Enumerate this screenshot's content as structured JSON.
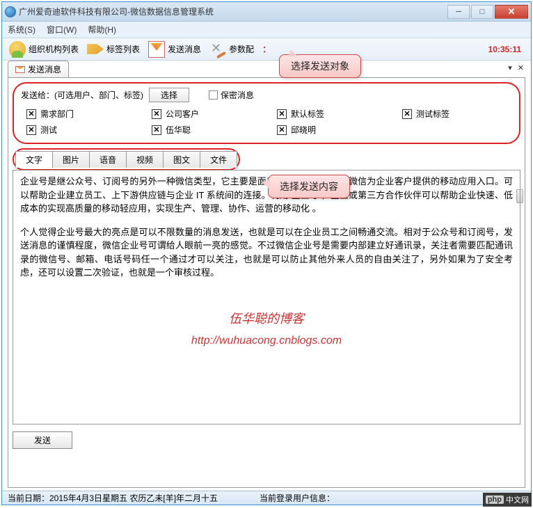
{
  "window": {
    "title": "广州爱奇迪软件科技有限公司-微信数据信息管理系统"
  },
  "menu": {
    "system": "系统(S)",
    "window": "窗口(W)",
    "help": "帮助(H)"
  },
  "toolbar": {
    "org": "组织机构列表",
    "tag": "标签列表",
    "msg": "发送消息",
    "settings": "参数配",
    "time": "10:35:11"
  },
  "tab": {
    "title": "发送消息",
    "dropdown": "▾",
    "close": "✕"
  },
  "callout": {
    "recipient": "选择发送对象",
    "content": "选择发送内容"
  },
  "recipient": {
    "label": "发送给：(可选用户、部门、标签)",
    "select_btn": "选择",
    "secret": "保密消息",
    "chips_row1": [
      "需求部门",
      "公司客户",
      "默认标签",
      "测试标签"
    ],
    "chips_row2": [
      "测试",
      "伍华聪",
      "邱晓明"
    ]
  },
  "content_tabs": [
    "文字",
    "图片",
    "语音",
    "视频",
    "图文",
    "文件"
  ],
  "editor": {
    "para1": "企业号是继公众号、订阅号的另外一种微信类型，它主要是面对企业的。企业号是微信为企业客户提供的移动应用入口。可以帮助企业建立员工、上下游供应链与企业 IT 系统间的连接。利用 企业号 ，企业或第三方合作伙伴可以帮助企业快速、低成本的实现高质量的移动轻应用，实现生产、管理、协作、运营的移动化 。",
    "para2": "个人觉得企业号最大的亮点是可以不限数量的消息发送，也就是可以在企业员工之间畅通交流。相对于公众号和订阅号，发送消息的谨慎程度，微信企业号可谓给人眼前一亮的感觉。不过微信企业号是需要内部建立好通讯录，关注者需要匹配通讯录的微信号、邮箱、电话号码任一个通过才可以关注，也就是可以防止其他外来人员的自由关注了，另外如果为了安全考虑，还可以设置二次验证，也就是一个审核过程。",
    "watermark_name": "伍华聪的博客",
    "watermark_url": "http://wuhuacong.cnblogs.com"
  },
  "send_btn": "发送",
  "status": {
    "date": "当前日期：2015年4月3日星期五 农历乙未[羊]年二月十五",
    "user": "当前登录用户信息："
  },
  "badge": {
    "p": "php",
    "cn": "中文网"
  }
}
